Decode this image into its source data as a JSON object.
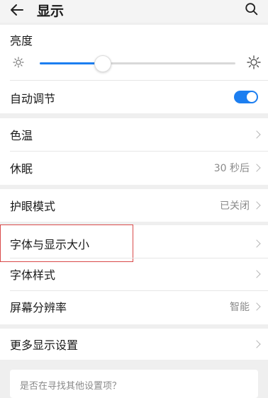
{
  "header": {
    "back_icon": "back-arrow-icon",
    "title": "显示",
    "search_icon": "search-icon"
  },
  "brightness": {
    "label": "亮度",
    "level_percent": 32,
    "low_icon": "sun-small-icon",
    "high_icon": "sun-large-icon",
    "auto_label": "自动调节",
    "auto_enabled": true
  },
  "group1": [
    {
      "label": "色温",
      "value": ""
    },
    {
      "label": "休眠",
      "value": "30 秒后"
    }
  ],
  "group2": [
    {
      "label": "护眼模式",
      "value": "已关闭"
    }
  ],
  "group3": [
    {
      "label": "字体与显示大小",
      "value": ""
    },
    {
      "label": "字体样式",
      "value": ""
    },
    {
      "label": "屏幕分辨率",
      "value": "智能"
    }
  ],
  "group4": [
    {
      "label": "更多显示设置",
      "value": ""
    }
  ],
  "search_hint": "是否在寻找其他设置项？",
  "colors": {
    "accent": "#1c7ef0",
    "highlight_border": "#d94a4a",
    "background": "#efefef",
    "card": "#ffffff"
  }
}
